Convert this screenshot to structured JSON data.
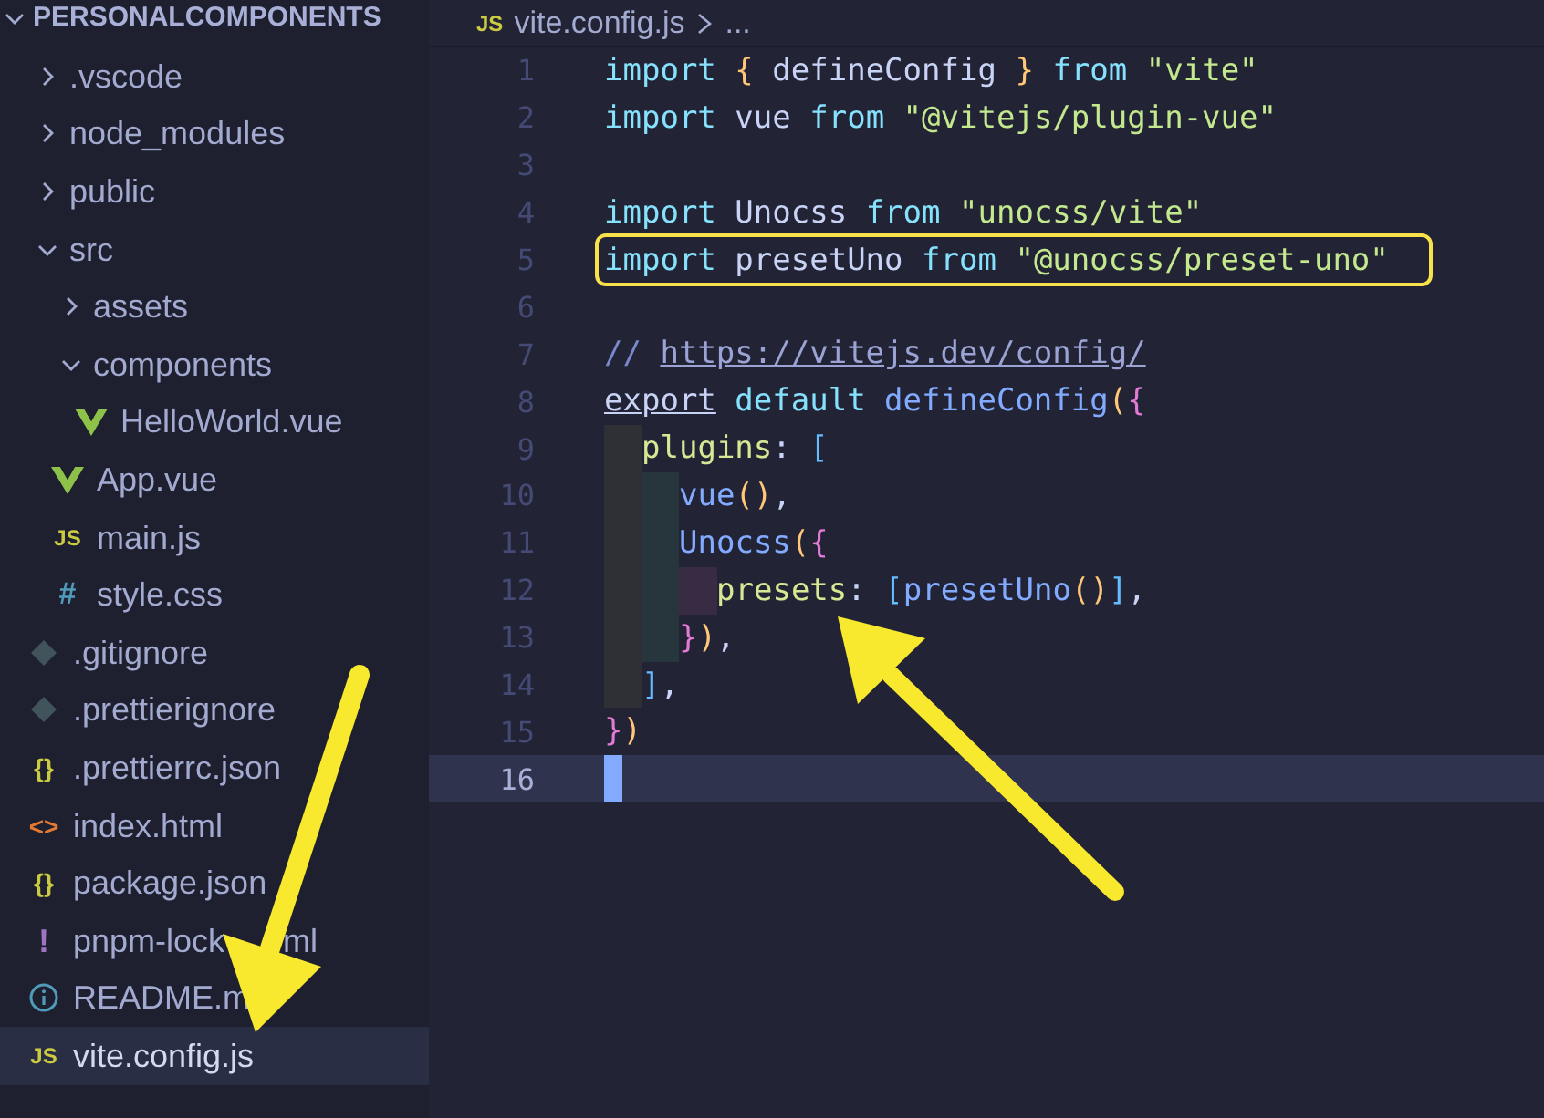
{
  "sidebar": {
    "root": {
      "label": "PERSONALCOMPONENTS",
      "expanded": true
    },
    "items": [
      {
        "kind": "folder",
        "name": ".vscode",
        "expanded": false
      },
      {
        "kind": "folder",
        "name": "node_modules",
        "expanded": false
      },
      {
        "kind": "folder",
        "name": "public",
        "expanded": false
      },
      {
        "kind": "folder",
        "name": "src",
        "expanded": true,
        "children": [
          {
            "kind": "folder",
            "name": "assets",
            "expanded": false
          },
          {
            "kind": "folder",
            "name": "components",
            "expanded": true,
            "children": [
              {
                "kind": "vue",
                "name": "HelloWorld.vue",
                "selected": false
              }
            ]
          },
          {
            "kind": "vue",
            "name": "App.vue",
            "selected": false
          },
          {
            "kind": "js",
            "glyph": "JS",
            "name": "main.js",
            "selected": false
          },
          {
            "kind": "css",
            "glyph": "#",
            "name": "style.css",
            "selected": false
          }
        ]
      },
      {
        "kind": "git",
        "name": ".gitignore",
        "selected": false
      },
      {
        "kind": "git",
        "name": ".prettierignore",
        "selected": false
      },
      {
        "kind": "json",
        "glyph": "{}",
        "name": ".prettierrc.json",
        "selected": false
      },
      {
        "kind": "html",
        "glyph": "<>",
        "name": "index.html",
        "selected": false
      },
      {
        "kind": "json",
        "glyph": "{}",
        "name": "package.json",
        "selected": false
      },
      {
        "kind": "lock",
        "glyph": "!",
        "name": "pnpm-lock",
        "name_tail": "ml",
        "selected": false
      },
      {
        "kind": "info",
        "name": "README.m",
        "selected": false
      },
      {
        "kind": "js",
        "glyph": "JS",
        "name": "vite.config.js",
        "selected": true
      }
    ]
  },
  "breadcrumb": {
    "file_glyph": "JS",
    "file": "vite.config.js",
    "rest": "..."
  },
  "editor": {
    "lines": [
      {
        "number": "1",
        "tokens": [
          {
            "t": "import ",
            "kind": "kw"
          },
          {
            "t": "{",
            "kind": "y"
          },
          {
            "t": " defineConfig ",
            "kind": "var"
          },
          {
            "t": "}",
            "kind": "y"
          },
          {
            "t": " from ",
            "kind": "kw"
          },
          {
            "t": "\"vite\"",
            "kind": "str"
          }
        ]
      },
      {
        "number": "2",
        "tokens": [
          {
            "t": "import",
            "kind": "kw"
          },
          {
            "t": " vue ",
            "kind": "var"
          },
          {
            "t": "from",
            "kind": "kw"
          },
          {
            "t": " \"@vitejs/plugin-vue\"",
            "kind": "str"
          }
        ]
      },
      {
        "number": "3"
      },
      {
        "number": "4",
        "tokens": [
          {
            "t": "import",
            "kind": "kw"
          },
          {
            "t": " Unocss ",
            "kind": "var"
          },
          {
            "t": "from",
            "kind": "kw"
          },
          {
            "t": " \"unocss/vite\"",
            "kind": "str"
          }
        ]
      },
      {
        "number": "5",
        "highlighted": true,
        "tokens": [
          {
            "t": "import",
            "kind": "kw"
          },
          {
            "t": " presetUno ",
            "kind": "var"
          },
          {
            "t": "from",
            "kind": "kw"
          },
          {
            "t": " \"@unocss/preset-uno\"",
            "kind": "str"
          }
        ]
      },
      {
        "number": "6"
      },
      {
        "number": "7",
        "tokens": [
          {
            "t": "// ",
            "kind": "comment"
          },
          {
            "t": "https://vitejs.dev/config/",
            "kind": "link"
          }
        ]
      },
      {
        "number": "8",
        "tokens": [
          {
            "t": "export",
            "kind": "under"
          },
          {
            "t": " default ",
            "kind": "kw"
          },
          {
            "t": "defineConfig",
            "kind": "fn"
          },
          {
            "t": "(",
            "kind": "y"
          },
          {
            "t": "{",
            "kind": "p"
          }
        ]
      },
      {
        "number": "9",
        "guides": [
          {
            "kind": "g1"
          }
        ],
        "tokens": [
          {
            "t": "plugins",
            "kind": "prop"
          },
          {
            "t": ": ",
            "kind": "punct"
          },
          {
            "t": "[",
            "kind": "b"
          }
        ]
      },
      {
        "number": "10",
        "guides": [
          {
            "kind": "g1"
          },
          {
            "kind": "g2"
          }
        ],
        "tokens": [
          {
            "t": "vue",
            "kind": "fn"
          },
          {
            "t": "()",
            "kind": "y"
          },
          {
            "t": ",",
            "kind": "punct"
          }
        ]
      },
      {
        "number": "11",
        "guides": [
          {
            "kind": "g1"
          },
          {
            "kind": "g2"
          }
        ],
        "tokens": [
          {
            "t": "Unocss",
            "kind": "fn"
          },
          {
            "t": "(",
            "kind": "y"
          },
          {
            "t": "{",
            "kind": "p"
          }
        ]
      },
      {
        "number": "12",
        "guides": [
          {
            "kind": "g1"
          },
          {
            "kind": "g2"
          },
          {
            "kind": "g3"
          }
        ],
        "tokens": [
          {
            "t": "presets",
            "kind": "prop"
          },
          {
            "t": ": ",
            "kind": "punct"
          },
          {
            "t": "[",
            "kind": "b"
          },
          {
            "t": "presetUno",
            "kind": "fn"
          },
          {
            "t": "()",
            "kind": "y"
          },
          {
            "t": "]",
            "kind": "b"
          },
          {
            "t": ",",
            "kind": "punct"
          }
        ]
      },
      {
        "number": "13",
        "guides": [
          {
            "kind": "g1"
          },
          {
            "kind": "g2"
          }
        ],
        "tokens": [
          {
            "t": "}",
            "kind": "p"
          },
          {
            "t": ")",
            "kind": "y"
          },
          {
            "t": ",",
            "kind": "punct"
          }
        ]
      },
      {
        "number": "14",
        "guides": [
          {
            "kind": "g1"
          }
        ],
        "tokens": [
          {
            "t": "]",
            "kind": "b"
          },
          {
            "t": ",",
            "kind": "punct"
          }
        ]
      },
      {
        "number": "15",
        "tokens": [
          {
            "t": "}",
            "kind": "p"
          },
          {
            "t": ")",
            "kind": "y"
          }
        ]
      },
      {
        "number": "16",
        "current": true
      }
    ]
  },
  "annotations": [
    {
      "kind": "arrow"
    },
    {
      "kind": "arrow"
    }
  ]
}
